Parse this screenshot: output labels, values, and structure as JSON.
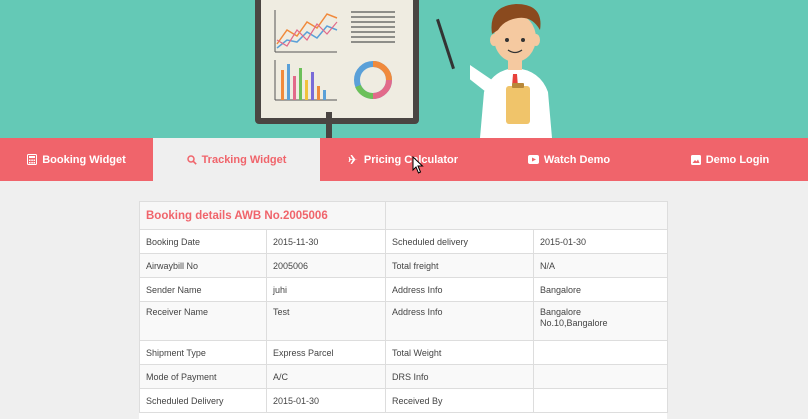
{
  "nav": {
    "items": [
      {
        "label": "Booking Widget",
        "icon": "calculator-icon"
      },
      {
        "label": "Tracking Widget",
        "icon": "search-icon"
      },
      {
        "label": "Pricing Calculator",
        "icon": "plane-icon"
      },
      {
        "label": "Watch Demo",
        "icon": "youtube-icon"
      },
      {
        "label": "Demo Login",
        "icon": "image-icon"
      }
    ],
    "active_index": 1
  },
  "details": {
    "title": "Booking details AWB No.2005006",
    "rows": [
      {
        "l1": "Booking Date",
        "v1": "2015-11-30",
        "l2": "Scheduled delivery",
        "v2": "2015-01-30"
      },
      {
        "l1": "Airwaybill No",
        "v1": "2005006",
        "l2": "Total freight",
        "v2": "N/A"
      },
      {
        "l1": "Sender Name",
        "v1": "juhi",
        "l2": "Address Info",
        "v2": "Bangalore"
      },
      {
        "l1": "Receiver Name",
        "v1": "Test",
        "l2": "Address Info",
        "v2_line1": "Bangalore",
        "v2_line2": "No.10,Bangalore"
      },
      {
        "l1": "Shipment Type",
        "v1": "Express Parcel",
        "l2": "Total Weight",
        "v2": ""
      },
      {
        "l1": "Mode of Payment",
        "v1": "A/C",
        "l2": "DRS Info",
        "v2": ""
      },
      {
        "l1": "Scheduled Delivery",
        "v1": "2015-01-30",
        "l2": "Received By",
        "v2": ""
      }
    ]
  },
  "colors": {
    "accent": "#f0646b",
    "hero_bg": "#64c9b6",
    "page_bg": "#efefef"
  }
}
